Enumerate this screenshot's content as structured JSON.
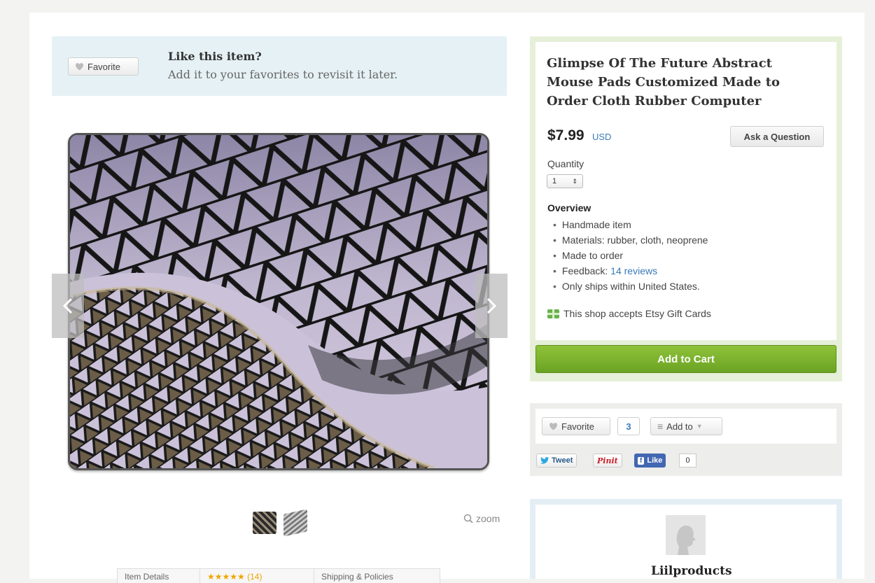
{
  "favorite_banner": {
    "button_label": "Favorite",
    "title": "Like this item?",
    "subtitle": "Add it to your favorites to revisit it later."
  },
  "gallery": {
    "zoom_label": "zoom"
  },
  "tabs": [
    "Item Details",
    "★★★★★ (14)",
    "Shipping & Policies"
  ],
  "listing": {
    "title": "Glimpse Of The Future Abstract Mouse Pads Customized Made to Order Cloth Rubber Computer",
    "price": "$7.99",
    "currency": "USD",
    "ask_button": "Ask a Question",
    "quantity_label": "Quantity",
    "quantity_value": "1",
    "overview_title": "Overview",
    "overview": {
      "item1": "Handmade item",
      "item2": "Materials: rubber, cloth, neoprene",
      "item3": "Made to order",
      "feedback_prefix": "Feedback: ",
      "feedback_link": "14 reviews",
      "item5": "Only ships within United States."
    },
    "gift_cards": "This shop accepts Etsy Gift Cards",
    "add_to_cart": "Add to Cart"
  },
  "social": {
    "favorite_label": "Favorite",
    "favorite_count": "3",
    "add_to_label": "Add to",
    "tweet_label": "Tweet",
    "pin_label": "Pinit",
    "like_label": "Like",
    "like_count": "0"
  },
  "shop": {
    "name": "Liilproducts"
  },
  "colors": {
    "cart_green": "#7ab52e",
    "link_blue": "#3a7ab8",
    "banner_blue": "#e5f1f5",
    "buybox_green": "#e6efd8"
  }
}
